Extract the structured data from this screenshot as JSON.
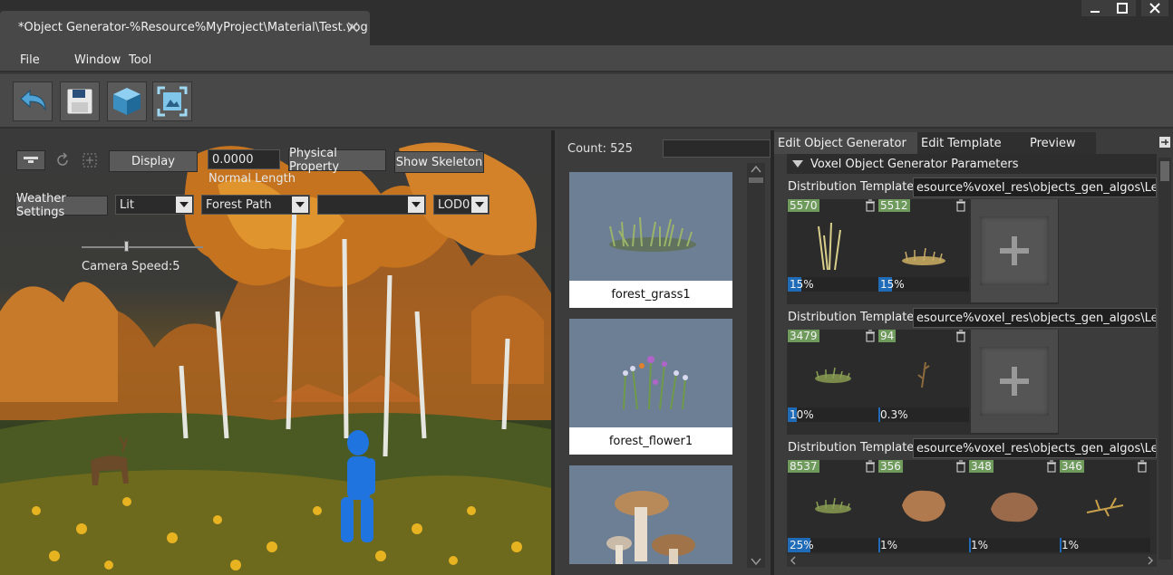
{
  "window": {
    "tab_title": "*Object Generator-%Resource%MyProject\\Material\\Test.vog"
  },
  "menu": {
    "file": "File",
    "window": "Window",
    "tool": "Tool"
  },
  "viewport": {
    "display_label": "Display",
    "normal_value": "0.0000",
    "normal_label": "Normal Length",
    "physical_property_label": "Physical Property",
    "show_skeleton_label": "Show Skeleton",
    "weather_label": "Weather Settings",
    "lighting_select": "Lit",
    "path_select": "Forest Path",
    "empty_select": "",
    "lod_select": "LOD0",
    "camera_speed_label": "Camera Speed:5",
    "camera_speed_value": 0.35
  },
  "assets": {
    "count_label": "Count: 525",
    "items": [
      {
        "name": "forest_grass1"
      },
      {
        "name": "forest_flower1"
      },
      {
        "name": ""
      }
    ]
  },
  "panel": {
    "tabs": [
      "Edit Object Generator",
      "Edit Template",
      "Preview"
    ],
    "section_title": "Voxel Object Generator Parameters",
    "groups": [
      {
        "label": "Distribution Template",
        "path": "esource%voxel_res\\objects_gen_algos\\Level_",
        "slots": [
          {
            "count": "5570",
            "pct": "15%",
            "fill": 0.15
          },
          {
            "count": "5512",
            "pct": "15%",
            "fill": 0.15
          }
        ]
      },
      {
        "label": "Distribution Template",
        "path": "esource%voxel_res\\objects_gen_algos\\Level_",
        "slots": [
          {
            "count": "3479",
            "pct": "10%",
            "fill": 0.1
          },
          {
            "count": "94",
            "pct": "0.3%",
            "fill": 0.003
          }
        ]
      },
      {
        "label": "Distribution Template",
        "path": "esource%voxel_res\\objects_gen_algos\\Level_",
        "slots": [
          {
            "count": "8537",
            "pct": "25%",
            "fill": 0.25
          },
          {
            "count": "356",
            "pct": "1%",
            "fill": 0.01
          },
          {
            "count": "348",
            "pct": "1%",
            "fill": 0.01
          },
          {
            "count": "346",
            "pct": "1%",
            "fill": 0.01
          }
        ]
      }
    ]
  },
  "colors": {
    "accent": "#1f6bb8",
    "count_badge": "#6e9b5c"
  }
}
